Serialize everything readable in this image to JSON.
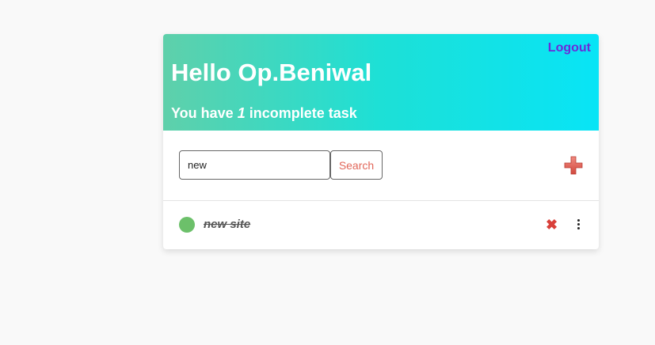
{
  "header": {
    "logout_label": "Logout",
    "greeting": "Hello Op.Beniwal",
    "subtitle_prefix": "You have ",
    "incomplete_count": "1",
    "subtitle_suffix": " incomplete task"
  },
  "toolbar": {
    "search_value": "new",
    "search_button_label": "Search",
    "add_icon": "plus-icon"
  },
  "tasks": [
    {
      "title": "new site",
      "completed": true,
      "status_color": "#6cc06a",
      "delete_icon": "close-icon",
      "menu_icon": "more-vertical-icon"
    }
  ],
  "colors": {
    "accent": "#6b2bd9",
    "header_gradient_start": "#5fd0aa",
    "header_gradient_end": "#08e4f6",
    "search_text": "#e2675a",
    "delete": "#d9403a"
  }
}
